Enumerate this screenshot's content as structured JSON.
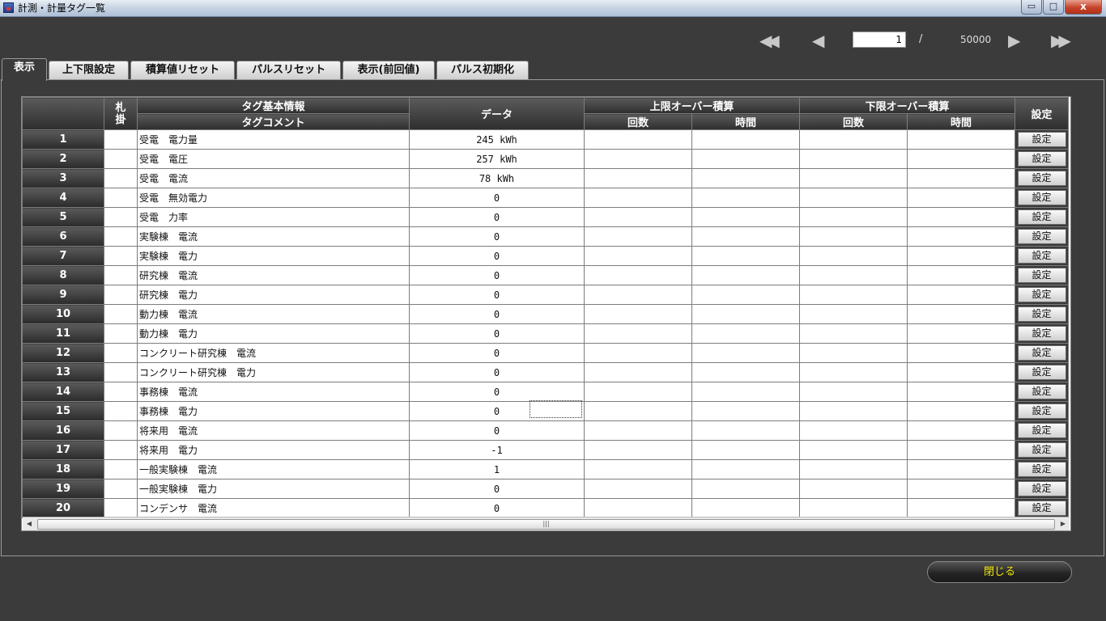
{
  "window": {
    "title": "計測・計量タグ一覧",
    "minimize_glyph": "▭",
    "maximize_glyph": "□",
    "close_glyph": "x"
  },
  "pager": {
    "first_icon": "◀◀",
    "prev_icon": "◀",
    "current_page": "1",
    "separator": "/",
    "total": "50000",
    "next_icon": "▶",
    "last_icon": "▶▶"
  },
  "tabs": [
    {
      "label": "表示",
      "active": true
    },
    {
      "label": "上下限設定"
    },
    {
      "label": "積算値リセット"
    },
    {
      "label": "パルスリセット"
    },
    {
      "label": "表示(前回値)"
    },
    {
      "label": "パルス初期化"
    }
  ],
  "grid": {
    "headers": {
      "tag_flag": "札\n掛",
      "tag_info": "タグ基本情報",
      "tag_comment": "タグコメント",
      "data": "データ",
      "upper_over": "上限オーバー積算",
      "lower_over": "下限オーバー積算",
      "count": "回数",
      "time": "時間",
      "setting": "設定"
    },
    "set_button_label": "設定",
    "rows": [
      {
        "no": "1",
        "comment": "受電　電力量",
        "data": "245 kWh"
      },
      {
        "no": "2",
        "comment": "受電　電圧",
        "data": "257 kWh"
      },
      {
        "no": "3",
        "comment": "受電　電流",
        "data": "78 kWh"
      },
      {
        "no": "4",
        "comment": "受電　無効電力",
        "data": "0"
      },
      {
        "no": "5",
        "comment": "受電　力率",
        "data": "0"
      },
      {
        "no": "6",
        "comment": "実験棟　電流",
        "data": "0"
      },
      {
        "no": "7",
        "comment": "実験棟　電力",
        "data": "0"
      },
      {
        "no": "8",
        "comment": "研究棟　電流",
        "data": "0"
      },
      {
        "no": "9",
        "comment": "研究棟　電力",
        "data": "0"
      },
      {
        "no": "10",
        "comment": "動力棟　電流",
        "data": "0"
      },
      {
        "no": "11",
        "comment": "動力棟　電力",
        "data": "0"
      },
      {
        "no": "12",
        "comment": "コンクリート研究棟　電流",
        "data": "0"
      },
      {
        "no": "13",
        "comment": "コンクリート研究棟　電力",
        "data": "0"
      },
      {
        "no": "14",
        "comment": "事務棟　電流",
        "data": "0"
      },
      {
        "no": "15",
        "comment": "事務棟　電力",
        "data": "0"
      },
      {
        "no": "16",
        "comment": "将来用　電流",
        "data": "0"
      },
      {
        "no": "17",
        "comment": "将来用　電力",
        "data": "-1"
      },
      {
        "no": "18",
        "comment": "一般実験棟　電流",
        "data": "1"
      },
      {
        "no": "19",
        "comment": "一般実験棟　電力",
        "data": "0"
      },
      {
        "no": "20",
        "comment": "コンデンサ　電流",
        "data": "0"
      }
    ]
  },
  "scrollbar": {
    "left_arrow": "◀",
    "right_arrow": "▶",
    "grip": "|||"
  },
  "close_button": "閉じる",
  "colors": {
    "accent_close_text": "#f2e700",
    "background": "#3b3b3b"
  }
}
